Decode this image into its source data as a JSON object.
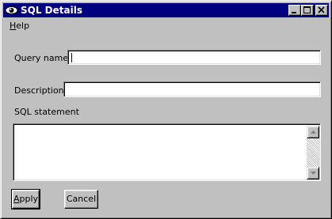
{
  "window": {
    "title": "SQL Details",
    "caption_buttons": [
      "minimize-icon",
      "maximize-icon",
      "close-icon"
    ],
    "app_icon": "eye-icon"
  },
  "menu": {
    "items": [
      {
        "first": "H",
        "rest": "elp"
      }
    ]
  },
  "form": {
    "query_name_label": "Query name:",
    "query_name_value": "",
    "description_label": "Description:",
    "description_value": "",
    "sql_label": "SQL statement",
    "sql_value": ""
  },
  "buttons": {
    "apply_first": "A",
    "apply_rest": "pply",
    "cancel": "Cancel"
  },
  "colors": {
    "titlebar": "#000080",
    "face": "#c0c0c0"
  }
}
